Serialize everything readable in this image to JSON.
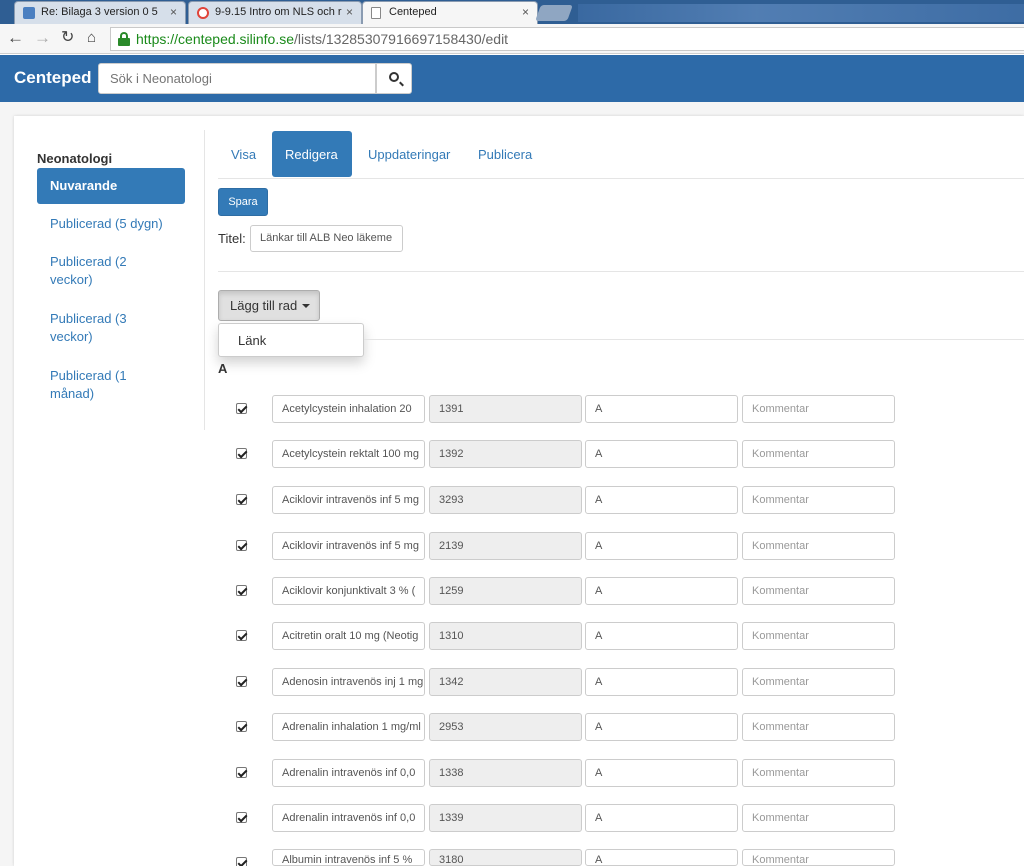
{
  "browser": {
    "tabs": [
      {
        "title": "Re: Bilaga 3 version 0 5",
        "icon": "outlook-icon",
        "color": "#4a7fc1"
      },
      {
        "title": "9-9.15 Intro om NLS och r",
        "icon": "google-icon",
        "color": "#e0443a"
      },
      {
        "title": "Centeped",
        "icon": "page-icon",
        "color": "#ffffff"
      }
    ],
    "tab_close": "×",
    "url_scheme": "https://",
    "url_host": "centeped.silinfo.se",
    "url_path": "/lists/13285307916697158430/edit"
  },
  "app": {
    "brand": "Centeped",
    "search_placeholder": "Sök i Neonatologi"
  },
  "sidebar": {
    "title": "Neonatologi",
    "items": [
      {
        "label": "Nuvarande",
        "active": true
      },
      {
        "label": "Publicerad (5 dygn)"
      },
      {
        "label": "Publicerad (2 veckor)"
      },
      {
        "label": "Publicerad (3 veckor)"
      },
      {
        "label": "Publicerad (1 månad)"
      }
    ]
  },
  "tabs": [
    "Visa",
    "Redigera",
    "Uppdateringar",
    "Publicera"
  ],
  "active_tab": "Redigera",
  "save_label": "Spara",
  "title_label": "Titel:",
  "title_value": "Länkar till ALB Neo läkeme",
  "add_row_label": "Lägg till rad",
  "dropdown_items": [
    "Länk"
  ],
  "section_letter": "A",
  "comment_placeholder": "Kommentar",
  "rows": [
    {
      "name": "Acetylcystein inhalation 20",
      "id": "1391",
      "letter": "A",
      "checked": true
    },
    {
      "name": "Acetylcystein rektalt 100 mg",
      "id": "1392",
      "letter": "A",
      "checked": true
    },
    {
      "name": "Aciklovir intravenös inf 5 mg",
      "id": "3293",
      "letter": "A",
      "checked": true
    },
    {
      "name": "Aciklovir intravenös inf 5 mg",
      "id": "2139",
      "letter": "A",
      "checked": true
    },
    {
      "name": "Aciklovir konjunktivalt 3 % (",
      "id": "1259",
      "letter": "A",
      "checked": true
    },
    {
      "name": "Acitretin oralt 10 mg (Neotig",
      "id": "1310",
      "letter": "A",
      "checked": true
    },
    {
      "name": "Adenosin intravenös inj 1 mg",
      "id": "1342",
      "letter": "A",
      "checked": true
    },
    {
      "name": "Adrenalin inhalation 1 mg/ml",
      "id": "2953",
      "letter": "A",
      "checked": true
    },
    {
      "name": "Adrenalin intravenös inf 0,0",
      "id": "1338",
      "letter": "A",
      "checked": true
    },
    {
      "name": "Adrenalin intravenös inf 0,0",
      "id": "1339",
      "letter": "A",
      "checked": true
    },
    {
      "name": "Albumin intravenös inf  5 %",
      "id": "3180",
      "letter": "A",
      "checked": true
    }
  ]
}
